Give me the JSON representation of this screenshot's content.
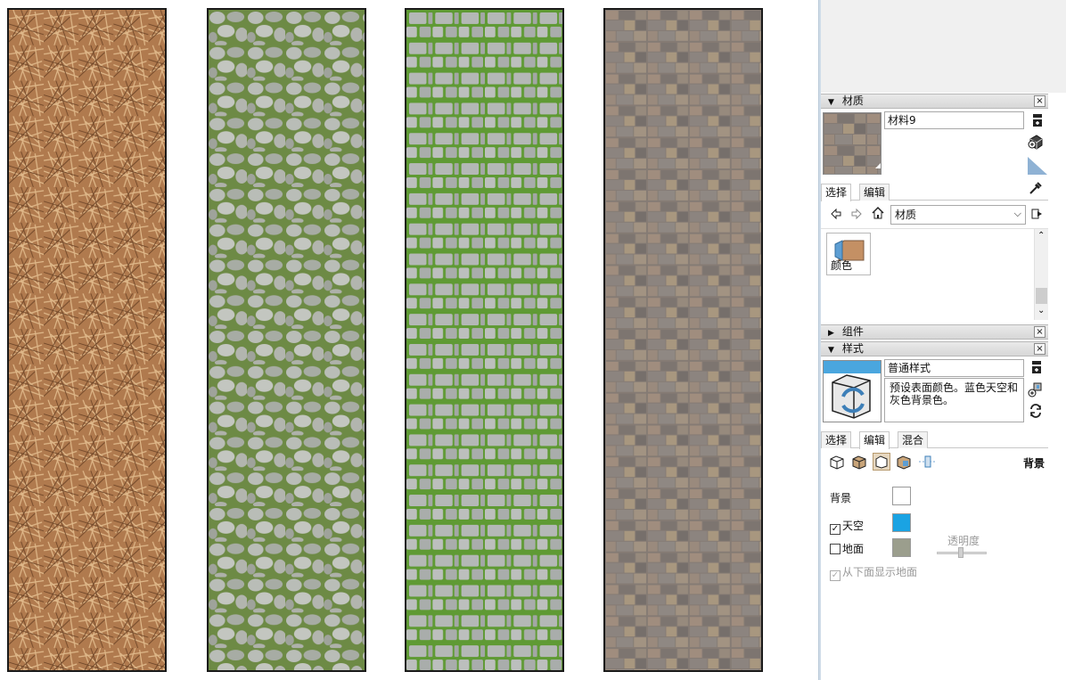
{
  "viewport": {
    "swatches": [
      {
        "name": "dry-grass",
        "base": "#b07a4e"
      },
      {
        "name": "cobblestone-moss",
        "base": "#9a9e96"
      },
      {
        "name": "grass-paver",
        "base": "#8d9d7c"
      },
      {
        "name": "stone-tile",
        "base": "#8a8079"
      }
    ]
  },
  "materials_panel": {
    "header": "材质",
    "close": "×",
    "material_name": "材料9",
    "tabs": [
      "选择",
      "编辑"
    ],
    "library_select": "材质",
    "library_items": [
      {
        "label": "颜色"
      }
    ]
  },
  "components_panel": {
    "header": "组件",
    "close": "×"
  },
  "styles_panel": {
    "header": "样式",
    "close": "×",
    "style_name": "普通样式",
    "style_description": "预设表面颜色。蓝色天空和灰色背景色。",
    "tabs": [
      "选择",
      "编辑",
      "混合"
    ],
    "section_title": "背景",
    "properties": {
      "background_label": "背景",
      "sky_label": "天空",
      "ground_label": "地面",
      "transparency_label": "透明度",
      "show_ground_below_label": "从下面显示地面"
    },
    "colors": {
      "background": "#ffffff",
      "sky": "#1aa3e3",
      "ground": "#9b9e8d"
    }
  },
  "checks": {
    "sky": "✓",
    "ground": "",
    "show_ground_below": "✓"
  }
}
